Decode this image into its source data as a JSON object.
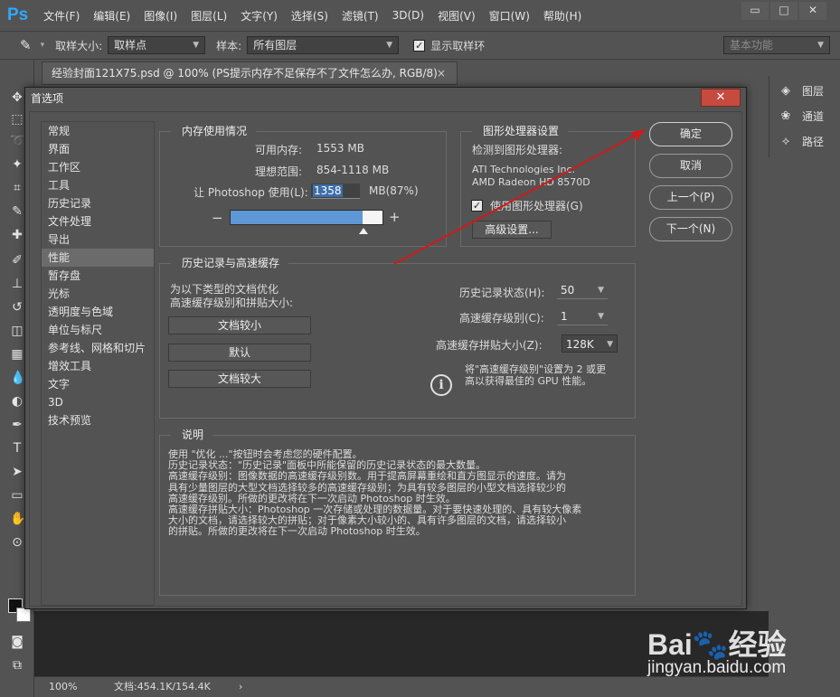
{
  "app": {
    "logo": "Ps",
    "menu": [
      "文件(F)",
      "编辑(E)",
      "图像(I)",
      "图层(L)",
      "文字(Y)",
      "选择(S)",
      "滤镜(T)",
      "3D(D)",
      "视图(V)",
      "窗口(W)",
      "帮助(H)"
    ],
    "window_buttons": [
      "▭",
      "□",
      "✕"
    ]
  },
  "options_bar": {
    "sample_size_label": "取样大小:",
    "sample_size_value": "取样点",
    "sample_label": "样本:",
    "sample_value": "所有图层",
    "show_ring_label": "显示取样环",
    "show_ring_checked": true,
    "workspace": "基本功能"
  },
  "document_tab": {
    "title": "经验封面121X75.psd @ 100% (PS提示内存不足保存不了文件怎么办, RGB/8)",
    "close": "×"
  },
  "right_panel": {
    "items": [
      {
        "label": "图层",
        "icon": "layers-icon"
      },
      {
        "label": "通道",
        "icon": "channels-icon"
      },
      {
        "label": "路径",
        "icon": "paths-icon"
      }
    ]
  },
  "status_bar": {
    "zoom": "100%",
    "doc_info": "文档:454.1K/154.4K",
    "arrow": "›"
  },
  "dialog": {
    "title": "首选项",
    "close": "✕",
    "categories": [
      "常规",
      "界面",
      "工作区",
      "工具",
      "历史记录",
      "文件处理",
      "导出",
      "性能",
      "暂存盘",
      "光标",
      "透明度与色域",
      "单位与标尺",
      "参考线、网格和切片",
      "增效工具",
      "文字",
      "3D",
      "技术预览"
    ],
    "active_category": "性能",
    "buttons": {
      "ok": "确定",
      "cancel": "取消",
      "prev": "上一个(P)",
      "next": "下一个(N)"
    },
    "memory": {
      "title": "内存使用情况",
      "available_label": "可用内存:",
      "available_value": "1553 MB",
      "ideal_label": "理想范围:",
      "ideal_value": "854-1118 MB",
      "use_label": "让 Photoshop 使用(L):",
      "use_value": "1358",
      "use_unit": "MB(87%)",
      "minus": "−",
      "plus": "+",
      "usage_fraction": 0.87
    },
    "gpu": {
      "title": "图形处理器设置",
      "detected_label": "检测到图形处理器:",
      "vendor": "ATI Technologies Inc.",
      "model": "AMD Radeon HD 8570D",
      "use_gpu_label": "使用图形处理器(G)",
      "use_gpu_checked": true,
      "advanced_button": "高级设置..."
    },
    "history_cache": {
      "title": "历史记录与高速缓存",
      "optimize_line1": "为以下类型的文档优化",
      "optimize_line2": "高速缓存级别和拼贴大小:",
      "btn_small": "文档较小",
      "btn_default": "默认",
      "btn_large": "文档较大",
      "history_states_label": "历史记录状态(H):",
      "history_states_value": "50",
      "cache_levels_label": "高速缓存级别(C):",
      "cache_levels_value": "1",
      "tile_size_label": "高速缓存拼贴大小(Z):",
      "tile_size_value": "128K",
      "info_line1": "将\"高速缓存级别\"设置为 2 或更",
      "info_line2": "高以获得最佳的 GPU 性能。"
    },
    "description": {
      "title": "说明",
      "text": "使用 \"优化 ...\"按钮时会考虑您的硬件配置。\n历史记录状态：\"历史记录\"面板中所能保留的历史记录状态的最大数量。\n高速缓存级别：图像数据的高速缓存级别数。用于提高屏幕重绘和直方图显示的速度。请为\n具有少量图层的大型文档选择较多的高速缓存级别；为具有较多图层的小型文档选择较少的\n高速缓存级别。所做的更改将在下一次启动 Photoshop 时生效。\n高速缓存拼贴大小：Photoshop 一次存储或处理的数据量。对于要快速处理的、具有较大像素\n大小的文档，请选择较大的拼贴；对于像素大小较小的、具有许多图层的文档，请选择较小\n的拼贴。所做的更改将在下一次启动 Photoshop 时生效。"
    }
  },
  "watermark": {
    "logo": "Bai🐾经验",
    "url": "jingyan.baidu.com"
  },
  "annotation_color": "#d11a1a"
}
